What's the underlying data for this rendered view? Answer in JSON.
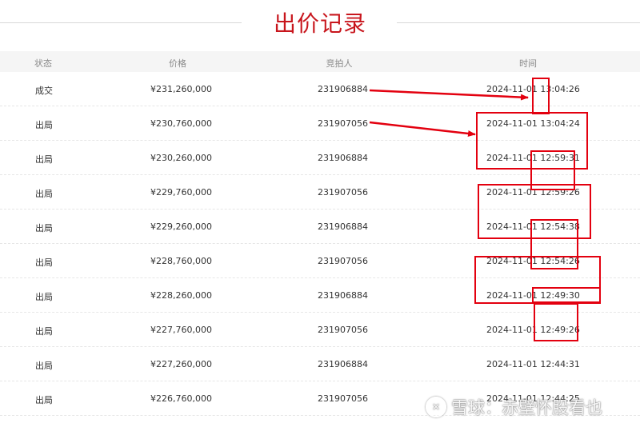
{
  "page": {
    "title": "出价记录"
  },
  "table": {
    "headers": {
      "status": "状态",
      "price": "价格",
      "bidder": "竞拍人",
      "time": "时间"
    },
    "rows": [
      {
        "status": "成交",
        "price": "¥231,260,000",
        "bidder": "231906884",
        "time": "2024-11-01 13:04:26"
      },
      {
        "status": "出局",
        "price": "¥230,760,000",
        "bidder": "231907056",
        "time": "2024-11-01 13:04:24"
      },
      {
        "status": "出局",
        "price": "¥230,260,000",
        "bidder": "231906884",
        "time": "2024-11-01 12:59:31"
      },
      {
        "status": "出局",
        "price": "¥229,760,000",
        "bidder": "231907056",
        "time": "2024-11-01 12:59:26"
      },
      {
        "status": "出局",
        "price": "¥229,260,000",
        "bidder": "231906884",
        "time": "2024-11-01 12:54:38"
      },
      {
        "status": "出局",
        "price": "¥228,760,000",
        "bidder": "231907056",
        "time": "2024-11-01 12:54:26"
      },
      {
        "status": "出局",
        "price": "¥228,260,000",
        "bidder": "231906884",
        "time": "2024-11-01 12:49:30"
      },
      {
        "status": "出局",
        "price": "¥227,760,000",
        "bidder": "231907056",
        "time": "2024-11-01 12:49:26"
      },
      {
        "status": "出局",
        "price": "¥227,260,000",
        "bidder": "231906884",
        "time": "2024-11-01 12:44:31"
      },
      {
        "status": "出局",
        "price": "¥226,760,000",
        "bidder": "231907056",
        "time": "2024-11-01 12:44:25"
      }
    ]
  },
  "annotations": {
    "color": "#e3000f"
  },
  "watermark": {
    "text": "雪球：赤壁怀股看也"
  },
  "colors": {
    "title": "#c8161d",
    "header_bg": "#f5f5f5"
  }
}
